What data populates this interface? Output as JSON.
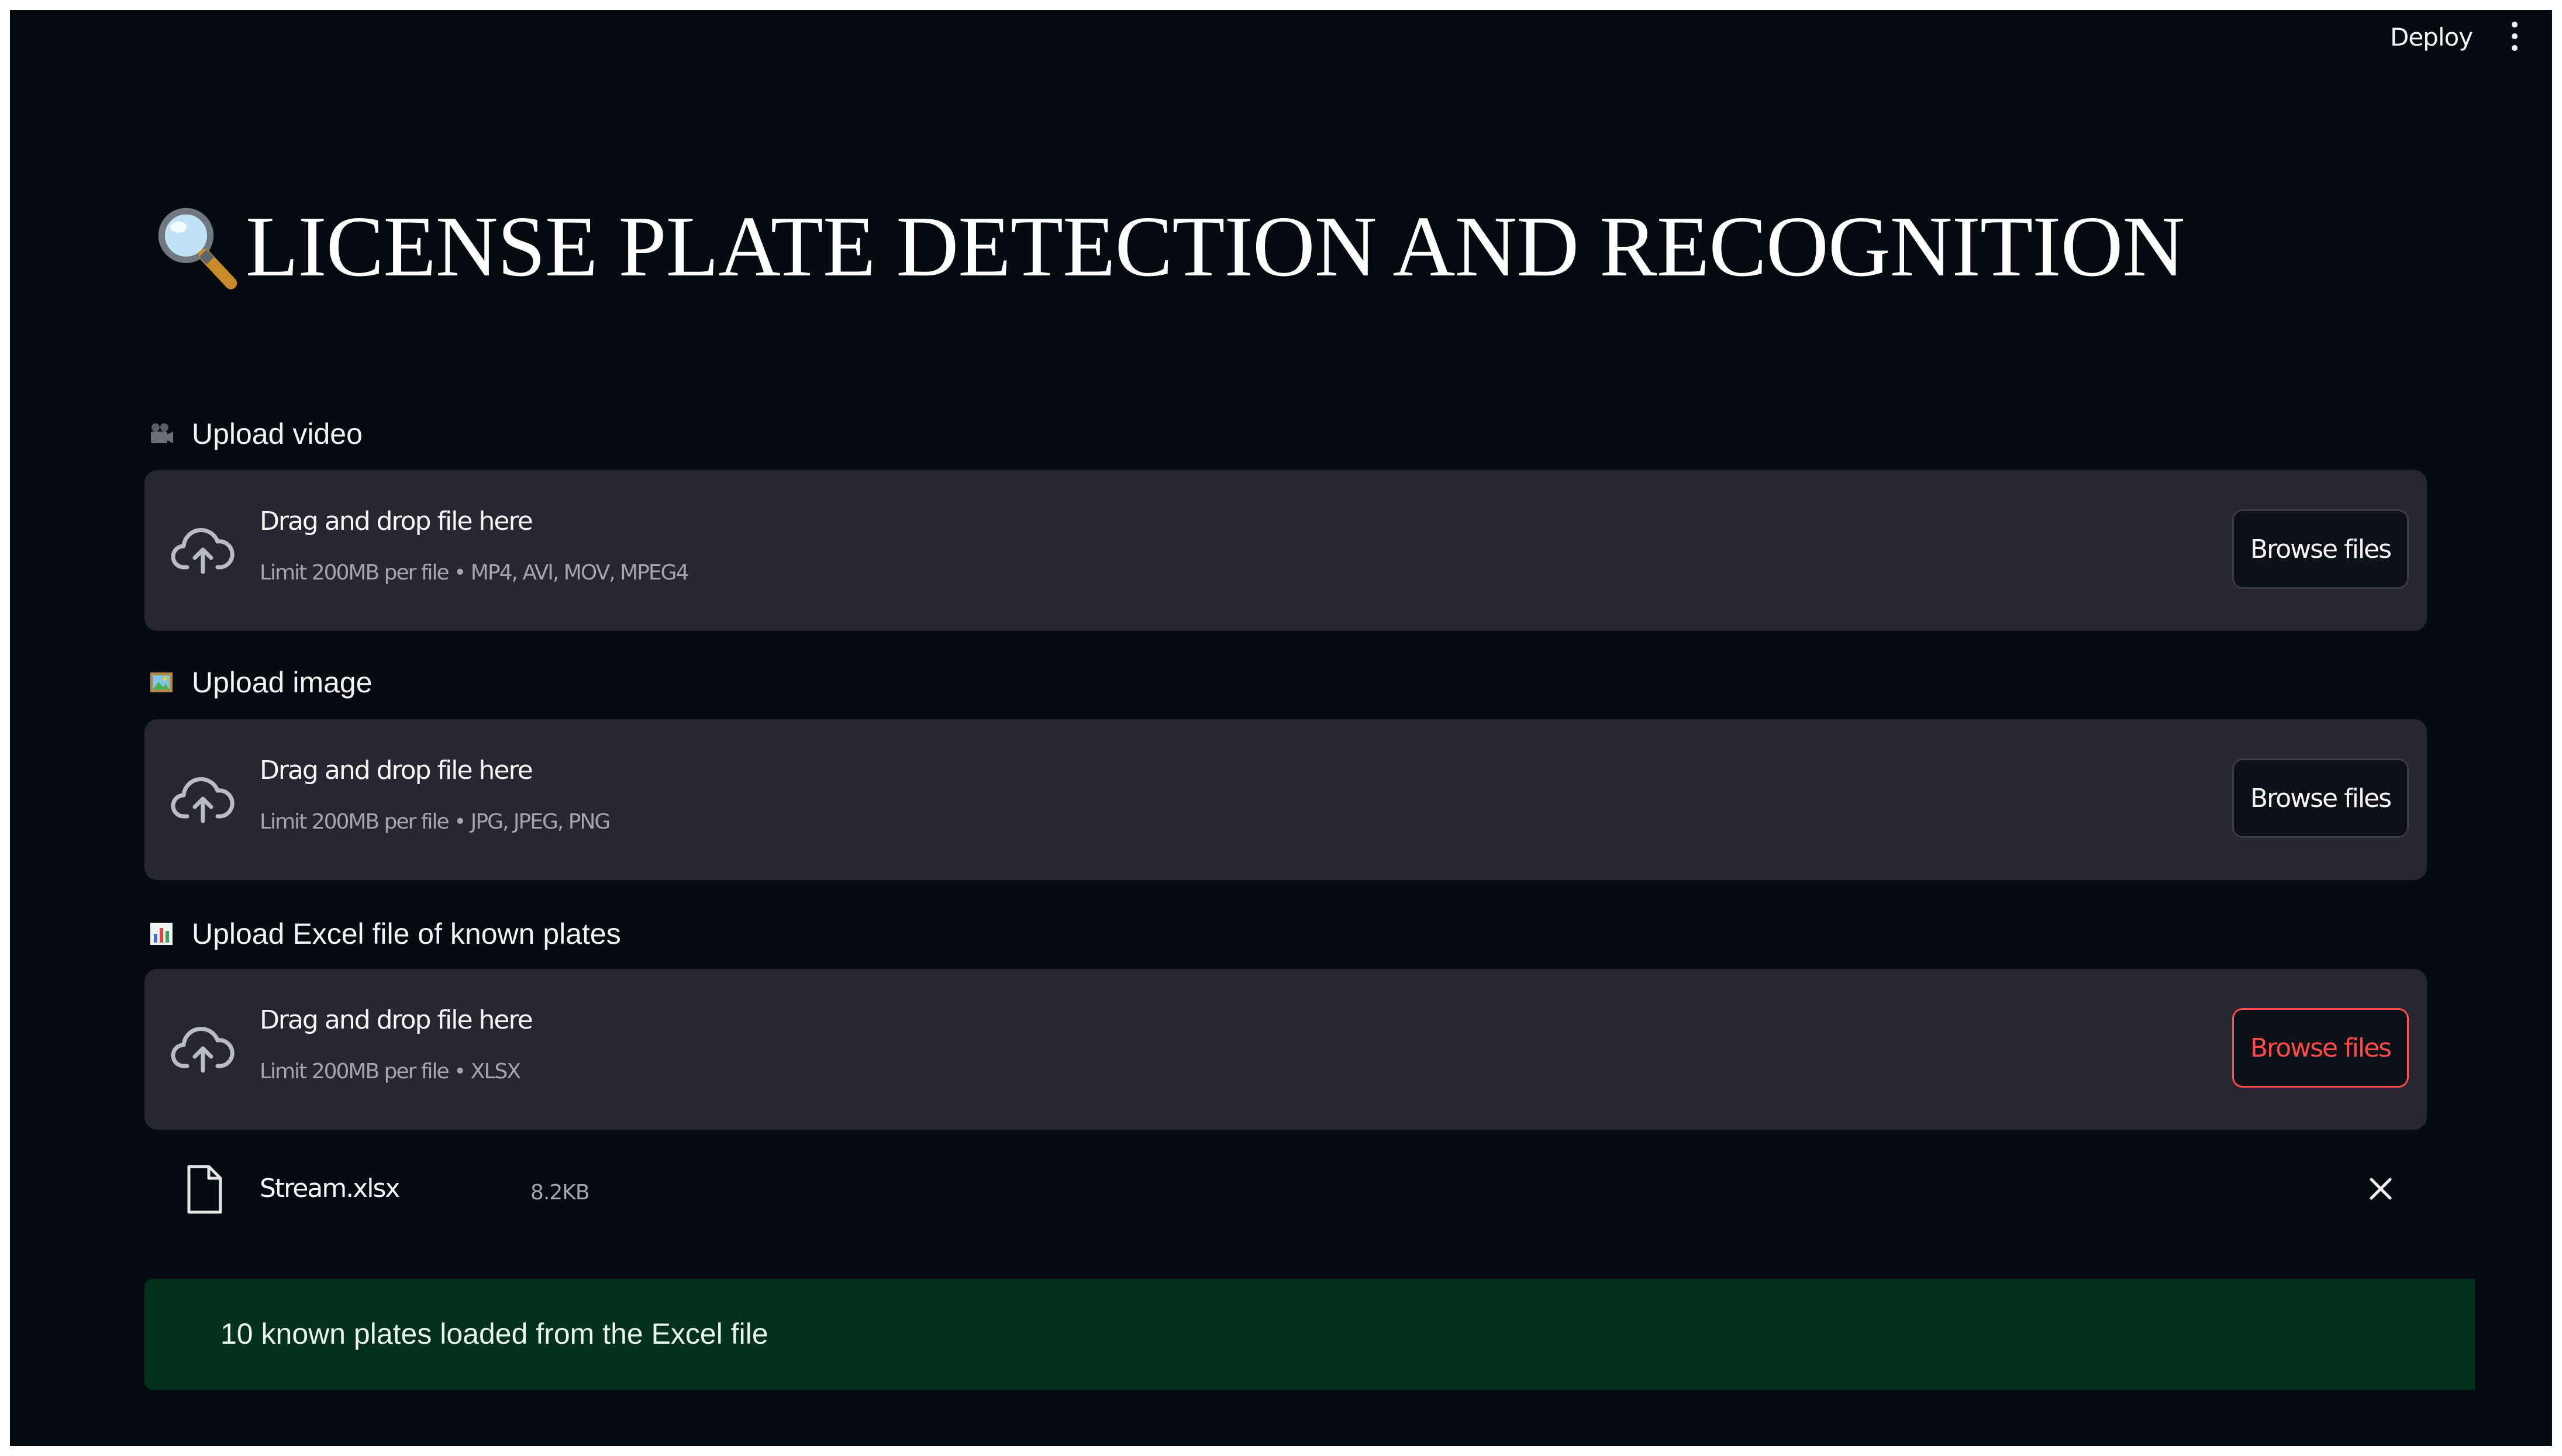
{
  "toolbar": {
    "deploy_label": "Deploy",
    "menu_icon": "kebab-menu-icon"
  },
  "header": {
    "title_icon": "magnifying-glass-icon",
    "title": "LICENSE PLATE DETECTION AND RECOGNITION"
  },
  "uploaders": [
    {
      "label": "Upload video",
      "label_icon": "movie-camera-icon",
      "dropzone_text": "Drag and drop file here",
      "limit_text": "Limit 200MB per file • MP4, AVI, MOV, MPEG4",
      "browse_label": "Browse files",
      "browse_state": "default"
    },
    {
      "label": "Upload image",
      "label_icon": "framed-picture-icon",
      "dropzone_text": "Drag and drop file here",
      "limit_text": "Limit 200MB per file • JPG, JPEG, PNG",
      "browse_label": "Browse files",
      "browse_state": "default"
    },
    {
      "label": "Upload Excel file of known plates",
      "label_icon": "bar-chart-icon",
      "dropzone_text": "Drag and drop file here",
      "limit_text": "Limit 200MB per file • XLSX",
      "browse_label": "Browse files",
      "browse_state": "active"
    }
  ],
  "uploaded_file": {
    "icon": "file-icon",
    "name": "Stream.xlsx",
    "size": "8.2KB",
    "remove_icon": "close-icon"
  },
  "status": {
    "message": "10 known plates loaded from the Excel file"
  },
  "colors": {
    "background": "#060a11",
    "dropzone": "#262730",
    "accent_red": "#ff4b4b",
    "success_bg": "#04311e"
  }
}
